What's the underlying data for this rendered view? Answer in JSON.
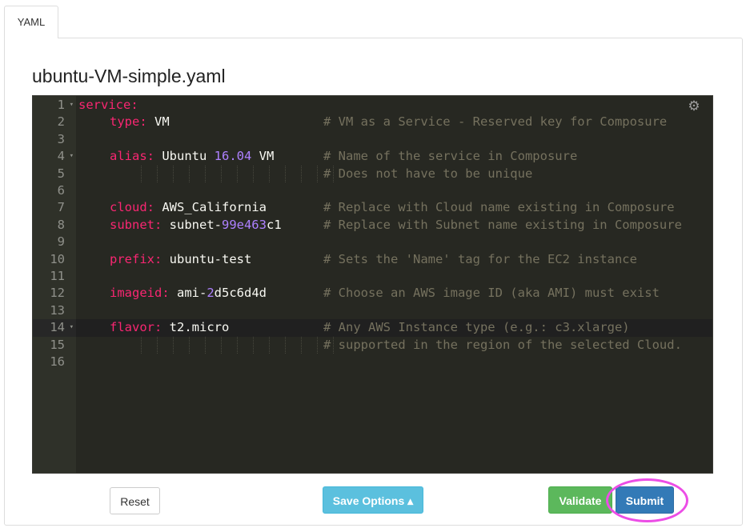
{
  "tab": {
    "label": "YAML"
  },
  "editor": {
    "filename": "ubuntu-VM-simple.yaml",
    "active_line": 14,
    "lines": [
      {
        "n": "1",
        "fold": true,
        "parts": [
          {
            "t": "service:",
            "c": "key",
            "indent": 0
          }
        ],
        "comment": ""
      },
      {
        "n": "2",
        "fold": false,
        "parts": [
          {
            "t": "type:",
            "c": "key",
            "indent": 1
          },
          {
            "t": " VM",
            "c": "val"
          }
        ],
        "comment": "# VM as a Service - Reserved key for Composure"
      },
      {
        "n": "3",
        "fold": false,
        "parts": [],
        "comment": ""
      },
      {
        "n": "4",
        "fold": true,
        "parts": [
          {
            "t": "alias:",
            "c": "key",
            "indent": 1
          },
          {
            "t": " Ubuntu ",
            "c": "val"
          },
          {
            "t": "16.04",
            "c": "num-c"
          },
          {
            "t": " VM",
            "c": "val"
          }
        ],
        "comment": "# Name of the service in Composure"
      },
      {
        "n": "5",
        "fold": false,
        "parts": [],
        "comment": "# Does not have to be unique",
        "guides": true
      },
      {
        "n": "6",
        "fold": false,
        "parts": [],
        "comment": ""
      },
      {
        "n": "7",
        "fold": false,
        "parts": [
          {
            "t": "cloud:",
            "c": "key",
            "indent": 1
          },
          {
            "t": " AWS_California",
            "c": "val"
          }
        ],
        "comment": "# Replace with Cloud name existing in Composure"
      },
      {
        "n": "8",
        "fold": false,
        "parts": [
          {
            "t": "subnet:",
            "c": "key",
            "indent": 1
          },
          {
            "t": " subnet-",
            "c": "val"
          },
          {
            "t": "99e463",
            "c": "num-c"
          },
          {
            "t": "c1",
            "c": "val"
          }
        ],
        "comment": "# Replace with Subnet name existing in Composure"
      },
      {
        "n": "9",
        "fold": false,
        "parts": [],
        "comment": ""
      },
      {
        "n": "10",
        "fold": false,
        "parts": [
          {
            "t": "prefix:",
            "c": "key",
            "indent": 1
          },
          {
            "t": " ubuntu-test",
            "c": "val"
          }
        ],
        "comment": "# Sets the 'Name' tag for the EC2 instance"
      },
      {
        "n": "11",
        "fold": false,
        "parts": [],
        "comment": ""
      },
      {
        "n": "12",
        "fold": false,
        "parts": [
          {
            "t": "imageid:",
            "c": "key",
            "indent": 1
          },
          {
            "t": " ami-",
            "c": "val"
          },
          {
            "t": "2",
            "c": "num-c"
          },
          {
            "t": "d5c6d4d",
            "c": "val"
          }
        ],
        "comment": "# Choose an AWS image ID (aka AMI) must exist"
      },
      {
        "n": "13",
        "fold": false,
        "parts": [],
        "comment": ""
      },
      {
        "n": "14",
        "fold": true,
        "parts": [
          {
            "t": "flavor:",
            "c": "key",
            "indent": 1
          },
          {
            "t": " t2.micro",
            "c": "val"
          }
        ],
        "comment": "# Any AWS Instance type (e.g.: c3.xlarge)"
      },
      {
        "n": "15",
        "fold": false,
        "parts": [],
        "comment": "# supported in the region of the selected Cloud.",
        "guides": true
      },
      {
        "n": "16",
        "fold": false,
        "parts": [],
        "comment": ""
      }
    ],
    "settings_icon": "gear-icon"
  },
  "buttons": {
    "reset": "Reset",
    "save_options": "Save Options ▴",
    "validate": "Validate",
    "submit": "Submit"
  },
  "colors": {
    "editor_bg": "#272822",
    "key": "#f92672",
    "number": "#ae81ff",
    "comment": "#75715e",
    "highlight_ring": "#ec4de6"
  }
}
